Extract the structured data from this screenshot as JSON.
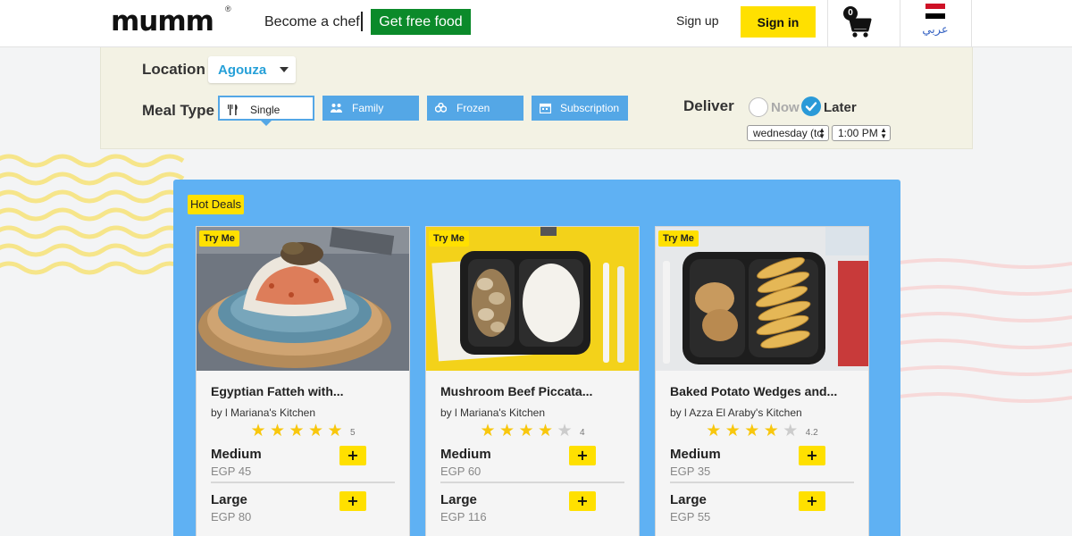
{
  "header": {
    "logo": "mumm",
    "logo_mark": "®",
    "become_chef": "Become a chef",
    "free_food": "Get free food",
    "sign_up": "Sign up",
    "sign_in": "Sign in",
    "cart_count": "0",
    "language": "عربي"
  },
  "filters": {
    "location_label": "Location",
    "location_value": "Agouza",
    "meal_type_label": "Meal Type",
    "meal_types": [
      {
        "label": "Single",
        "icon": "fork-knife-icon",
        "active": true
      },
      {
        "label": "Family",
        "icon": "family-icon",
        "active": false
      },
      {
        "label": "Frozen",
        "icon": "snowflake-icon",
        "active": false
      },
      {
        "label": "Subscription",
        "icon": "calendar-icon",
        "active": false
      }
    ],
    "deliver_label": "Deliver",
    "deliver_now": "Now",
    "deliver_later": "Later",
    "deliver_selected": "Later",
    "day_value": "wednesday (to",
    "time_value": "1:00 PM"
  },
  "deals": {
    "badge": "Hot Deals",
    "cards": [
      {
        "tag": "Try Me",
        "title": "Egyptian Fatteh with...",
        "chef": "by l Mariana's Kitchen",
        "stars": 5,
        "rating": "5",
        "sizes": [
          {
            "name": "Medium",
            "price": "EGP 45"
          },
          {
            "name": "Large",
            "price": "EGP 80"
          }
        ]
      },
      {
        "tag": "Try Me",
        "title": "Mushroom Beef Piccata...",
        "chef": "by l Mariana's Kitchen",
        "stars": 4,
        "rating": "4",
        "sizes": [
          {
            "name": "Medium",
            "price": "EGP 60"
          },
          {
            "name": "Large",
            "price": "EGP 116"
          }
        ]
      },
      {
        "tag": "Try Me",
        "title": "Baked Potato Wedges and...",
        "chef": "by l Azza El Araby's Kitchen",
        "stars": 4,
        "rating": "4.2",
        "sizes": [
          {
            "name": "Medium",
            "price": "EGP 35"
          },
          {
            "name": "Large",
            "price": "EGP 55"
          }
        ]
      }
    ],
    "add_label": "+"
  },
  "colors": {
    "accent_yellow": "#ffe000",
    "brand_green": "#0b8a2a",
    "meal_blue": "#54a7e6",
    "deals_blue": "#5fb1f3",
    "star_gold": "#f8c70d"
  }
}
